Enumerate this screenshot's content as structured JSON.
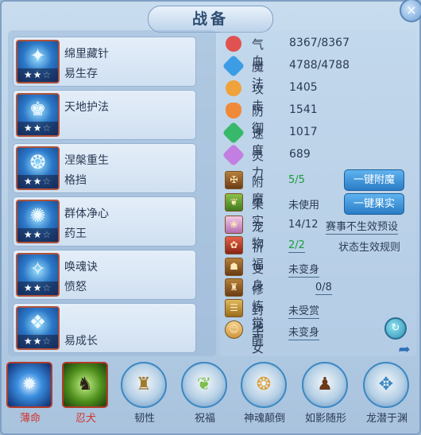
{
  "window": {
    "title": "战备",
    "close_icon": "×"
  },
  "skills": [
    {
      "name": "绵里藏针",
      "sub": "易生存",
      "stars_on": 2,
      "stars_total": 3,
      "glyph": "✦"
    },
    {
      "name": "天地护法",
      "sub": "",
      "stars_on": 2,
      "stars_total": 3,
      "glyph": "♚"
    },
    {
      "name": "涅槃重生",
      "sub": "格挡",
      "stars_on": 2,
      "stars_total": 3,
      "glyph": "❂"
    },
    {
      "name": "群体净心",
      "sub": "药王",
      "stars_on": 2,
      "stars_total": 3,
      "glyph": "✺"
    },
    {
      "name": "唤魂诀",
      "sub": "愤怒",
      "stars_on": 2,
      "stars_total": 3,
      "glyph": "✧"
    },
    {
      "name": "",
      "sub": "易成长",
      "stars_on": 2,
      "stars_total": 3,
      "glyph": "❖"
    }
  ],
  "stats": [
    {
      "label": "气血",
      "value": "8367/8367",
      "color": "#e0524f",
      "icon": "heart-icon"
    },
    {
      "label": "魔法",
      "value": "4788/4788",
      "color": "#3c9de6",
      "icon": "mana-icon"
    },
    {
      "label": "攻击",
      "value": "1405",
      "color": "#f0a23b",
      "icon": "sword-icon"
    },
    {
      "label": "防御",
      "value": "1541",
      "color": "#f08a3b",
      "icon": "shield-icon"
    },
    {
      "label": "速度",
      "value": "1017",
      "color": "#37b86a",
      "icon": "speed-icon"
    },
    {
      "label": "灵力",
      "value": "689",
      "color": "#c27ee0",
      "icon": "spirit-icon"
    }
  ],
  "equip": {
    "enchant": {
      "label": "附魔",
      "value": "5/5"
    },
    "fruit": {
      "label": "果实",
      "value": "未使用"
    },
    "pet": {
      "label": "宠物",
      "value": "14/12"
    },
    "pray": {
      "label": "祈福",
      "value": "2/2"
    },
    "transform": {
      "label": "变身",
      "value": "未变身"
    },
    "awaken": {
      "label": "修炼觉醒",
      "value": "0/8"
    },
    "fief": {
      "label": "封地",
      "value": "未受赏"
    },
    "child": {
      "label": "子女",
      "value": "未变身"
    }
  },
  "buttons": {
    "one_click_enchant": "一键附魔",
    "one_click_fruit": "一键果实",
    "tournament_preset": "赛事不生效预设",
    "status_rules": "状态生效规则"
  },
  "talents": [
    {
      "label": "薄命",
      "icon": "blue-orb-icon",
      "highlight": true
    },
    {
      "label": "忍犬",
      "icon": "wolf-icon",
      "highlight": true
    },
    {
      "label": "韧性",
      "icon": "golem-icon",
      "highlight": false
    },
    {
      "label": "祝福",
      "icon": "lotus-icon",
      "highlight": false
    },
    {
      "label": "神魂颠倒",
      "icon": "fan-icon",
      "highlight": false
    },
    {
      "label": "如影随形",
      "icon": "shadow-icon",
      "highlight": false
    },
    {
      "label": "龙潜于渊",
      "icon": "dragon-icon",
      "highlight": false
    }
  ]
}
